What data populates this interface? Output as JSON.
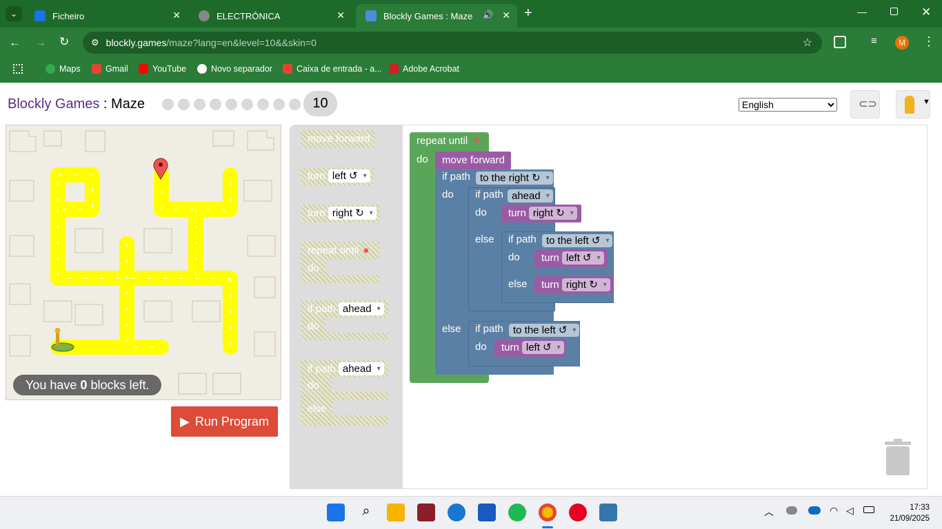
{
  "browser": {
    "tabs": [
      {
        "title": "Ficheiro",
        "active": false
      },
      {
        "title": "ELECTRÓNICA",
        "active": false
      },
      {
        "title": "Blockly Games : Maze",
        "active": true
      }
    ],
    "url_host": "blockly.games",
    "url_path": "/maze?lang=en&level=10&&skin=0",
    "profile_initial": "M",
    "bookmarks": [
      "Maps",
      "Gmail",
      "YouTube",
      "Novo separador",
      "Caixa de entrada - a...",
      "Adobe Acrobat"
    ]
  },
  "page": {
    "title_brand": "Blockly Games",
    "title_sep": " : ",
    "title_game": "Maze",
    "current_level": "10",
    "language": "English",
    "blocks_left_prefix": "You have ",
    "blocks_left_count": "0",
    "blocks_left_suffix": " blocks left.",
    "run_label": "Run Program"
  },
  "toolbox": {
    "move_forward": "move forward",
    "turn": "turn",
    "left": "left ↺",
    "right": "right ↻",
    "repeat_until": "repeat until",
    "do": "do",
    "else": "else",
    "if_path": "if path",
    "ahead": "ahead"
  },
  "program": {
    "repeat_until": "repeat until",
    "do": "do",
    "else": "else",
    "move_forward": "move forward",
    "if_path": "if path",
    "turn": "turn",
    "to_the_right": "to the right ↻",
    "to_the_left": "to the left ↺",
    "ahead": "ahead",
    "right": "right ↻",
    "left": "left ↺"
  },
  "taskbar": {
    "time": "17:33",
    "date": "21/09/2025"
  },
  "colors": {
    "chrome": "#2a7c38",
    "repeat": "#5ba55b",
    "logic": "#5b80a5",
    "movement": "#9a5ba5",
    "run": "#dd4b39"
  }
}
